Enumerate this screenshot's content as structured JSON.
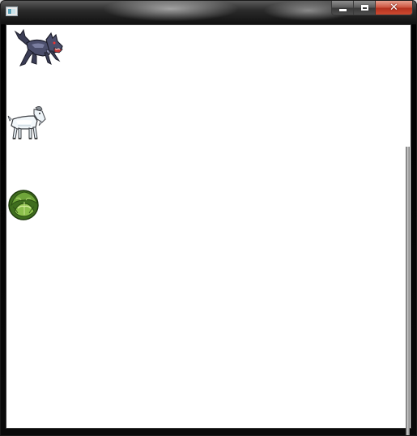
{
  "window": {
    "title": "",
    "controls": {
      "minimize": "minimize",
      "maximize": "maximize",
      "close": "✕"
    }
  },
  "scene": {
    "sprites": [
      {
        "name": "wolf",
        "icon": "wolf-icon"
      },
      {
        "name": "goat",
        "icon": "goat-icon"
      },
      {
        "name": "cabbage",
        "icon": "cabbage-icon"
      }
    ]
  }
}
